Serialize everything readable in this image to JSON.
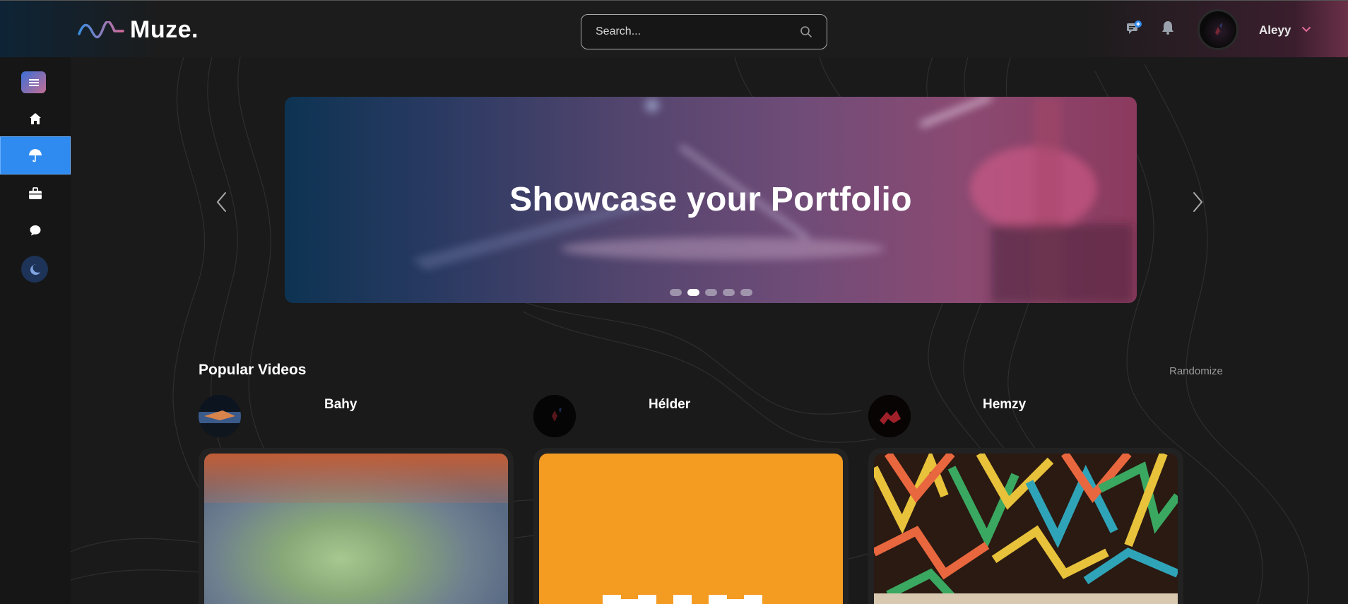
{
  "brand": {
    "name": "Muze."
  },
  "search": {
    "placeholder": "Search..."
  },
  "user": {
    "name": "Aleyy"
  },
  "carousel": {
    "title": "Showcase your Portfolio",
    "slide_count": 5,
    "active_slide": 2
  },
  "popular": {
    "title": "Popular Videos",
    "randomize_label": "Randomize",
    "creators": [
      {
        "name": "Bahy"
      },
      {
        "name": "Hélder"
      },
      {
        "name": "Hemzy"
      }
    ]
  },
  "colors": {
    "accent_blue": "#2f8bf0",
    "accent_pink": "#c46e93",
    "background": "#1a1a1a"
  },
  "icons": [
    "menu-icon",
    "home-icon",
    "umbrella-icon",
    "briefcase-icon",
    "chat-icon",
    "moon-icon",
    "search-icon",
    "chat-notification-icon",
    "bell-icon",
    "chevron-down-icon"
  ]
}
